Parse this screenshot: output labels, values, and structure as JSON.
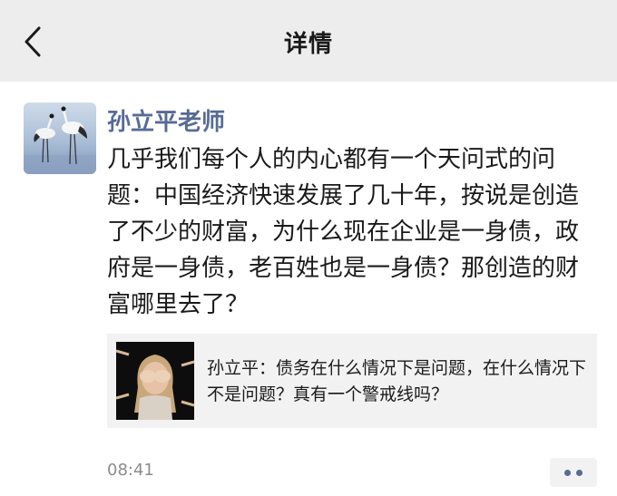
{
  "nav": {
    "title": "详情",
    "back_icon": "chevron-left-icon"
  },
  "post": {
    "author": "孙立平老师",
    "avatar_icon": "crane-photo",
    "text": "几乎我们每个人的内心都有一个天问式的问题：中国经济快速发展了几十年，按说是创造了不少的财富，为什么现在企业是一身债，政府是一身债，老百姓也是一身债？那创造的财富哪里去了？",
    "shared_article": {
      "title": "孙立平：债务在什么情况下是问题，在什么情况下不是问题？真有一个警戒线吗？",
      "thumbnail_icon": "covered-eyes-photo"
    },
    "time": "08:41",
    "more_icon": "more-dots-icon"
  },
  "colors": {
    "nav_background": "#ededed",
    "link_blue": "#576b95",
    "card_background": "#f2f2f2",
    "muted_text": "#8c8c8c"
  }
}
